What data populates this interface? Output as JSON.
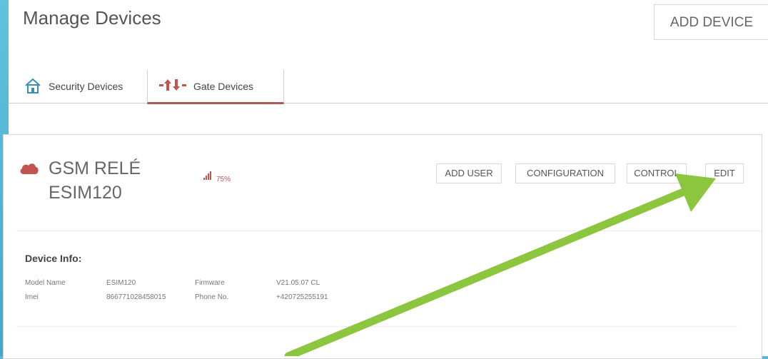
{
  "page": {
    "title": "Manage Devices",
    "add_device_label": "ADD DEVICE"
  },
  "tabs": [
    {
      "label": "Security Devices",
      "icon": "home-icon",
      "active": false
    },
    {
      "label": "Gate Devices",
      "icon": "gate-arrows-icon",
      "active": true
    }
  ],
  "device": {
    "name_line1": "GSM RELÉ",
    "name_line2": "ESIM120",
    "status_icon": "cloud-icon",
    "signal_icon": "signal-bars-icon",
    "signal_percent": "75%",
    "actions": {
      "add_user": "ADD USER",
      "configuration": "CONFIGURATION",
      "control": "CONTROL",
      "edit": "EDIT"
    },
    "info": {
      "title": "Device Info:",
      "model_name_label": "Model Name",
      "model_name_value": "ESIM120",
      "firmware_label": "Firmware",
      "firmware_value": "V21.05.07 CL",
      "imei_label": "Imei",
      "imei_value": "866771028458015",
      "phone_label": "Phone No.",
      "phone_value": "+420725255191"
    }
  },
  "colors": {
    "frame": "#4fb4d6",
    "accent": "#c0554f",
    "annotation_arrow": "#8cc63f"
  }
}
